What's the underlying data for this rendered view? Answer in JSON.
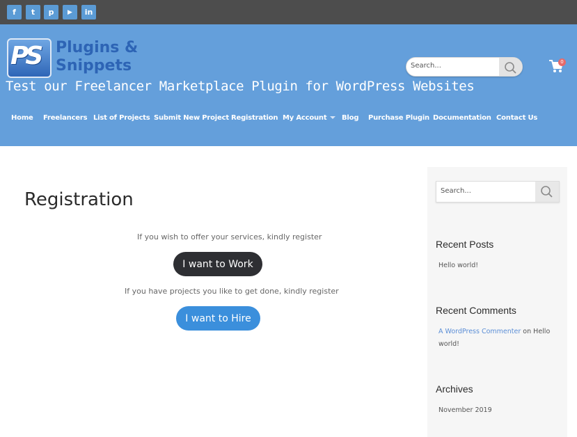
{
  "social": [
    {
      "icon": "facebook-icon",
      "glyph": "f"
    },
    {
      "icon": "twitter-icon",
      "glyph": "t"
    },
    {
      "icon": "pinterest-icon",
      "glyph": "p"
    },
    {
      "icon": "youtube-icon",
      "glyph": "▶"
    },
    {
      "icon": "linkedin-icon",
      "glyph": "in"
    }
  ],
  "brand": {
    "line1": "Plugins &",
    "line2": "Snippets",
    "logo_mark": "PS"
  },
  "tagline": "Test our Freelancer Marketplace Plugin for WordPress Websites",
  "header_search": {
    "placeholder": "Search..."
  },
  "cart": {
    "count": "0"
  },
  "nav": [
    "Home",
    "Freelancers",
    "List of Projects",
    "Submit New Project",
    "Registration",
    "My Account",
    "Blog",
    "Purchase Plugin",
    "Documentation",
    "Contact Us"
  ],
  "main": {
    "title": "Registration",
    "work_note": "If you wish to offer your services, kindly register",
    "work_button": "I want to Work",
    "hire_note": "If you have projects you like to get done, kindly register",
    "hire_button": "I want to Hire"
  },
  "sidebar": {
    "search_placeholder": "Search...",
    "recent_posts_title": "Recent Posts",
    "recent_posts": [
      "Hello world!"
    ],
    "recent_comments_title": "Recent Comments",
    "comment_author": "A WordPress Commenter",
    "comment_on": "on",
    "comment_post": "Hello world!",
    "archives_title": "Archives",
    "archives": [
      "November 2019"
    ]
  },
  "colors": {
    "header": "#649fdb",
    "topbar": "#4d4d4d",
    "work_button": "#2e2f33",
    "hire_button": "#3b8fdc"
  }
}
